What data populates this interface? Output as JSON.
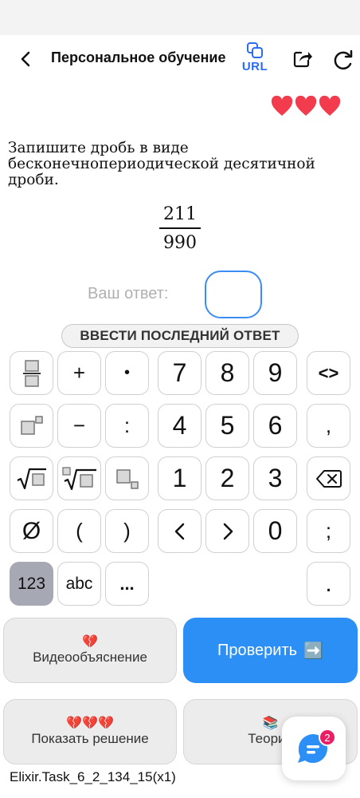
{
  "header": {
    "title": "Персональное обучение",
    "url_label": "URL"
  },
  "lives": {
    "count": 3,
    "color": "#f23c4d"
  },
  "task": {
    "text": "Запишите дробь в виде бесконечнопериодической десятичной дроби.",
    "numerator": "211",
    "denominator": "990"
  },
  "answer": {
    "label": "Ваш ответ:",
    "value": ""
  },
  "last_answer_button": "ВВЕСТИ ПОСЛЕДНИЙ ОТВЕТ",
  "keypad": {
    "plus": "+",
    "dot": "•",
    "minus": "−",
    "colon": ":",
    "comma": ",",
    "lparen": "(",
    "rparen": ")",
    "semicolon": ";",
    "period": ".",
    "tags": "<>",
    "empty_set": "Ø",
    "more": "...",
    "d7": "7",
    "d8": "8",
    "d9": "9",
    "d4": "4",
    "d5": "5",
    "d6": "6",
    "d1": "1",
    "d2": "2",
    "d3": "3",
    "d0": "0",
    "mode_numbers": "123",
    "mode_letters": "abc"
  },
  "actions": {
    "video": {
      "emoji": "💔",
      "label": "Видеообъяснение"
    },
    "check": {
      "label": "Проверить",
      "emoji": "➡️"
    },
    "solution": {
      "emoji": "💔💔💔",
      "label": "Показать решение"
    },
    "theory": {
      "emoji": "📚",
      "label": "Теория"
    }
  },
  "task_id": "Elixir.Task_6_2_134_15(x1)",
  "chat": {
    "badge": "2"
  },
  "colors": {
    "accent": "#2c8ff5",
    "heart": "#f23c4d",
    "active_mode": "#a6a9b3"
  }
}
